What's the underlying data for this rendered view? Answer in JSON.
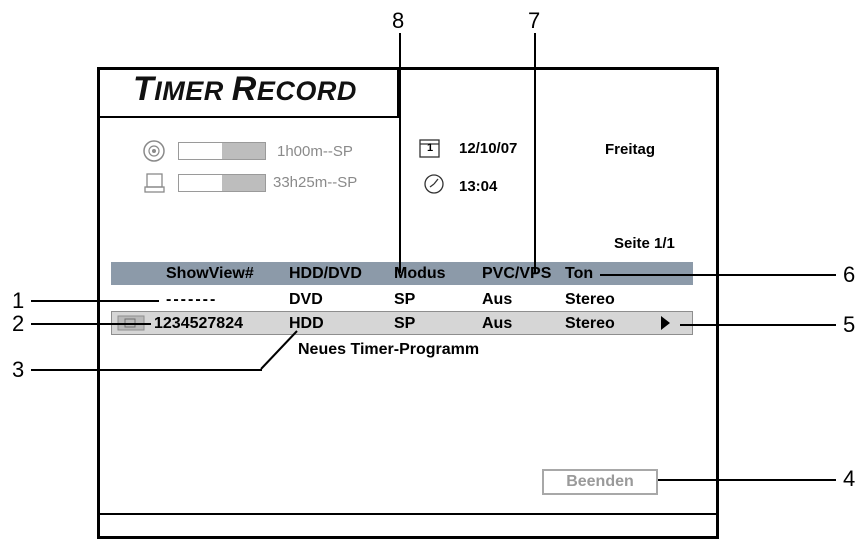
{
  "title": {
    "first_cap": "T",
    "rest1": "IMER ",
    "second_cap": "R",
    "rest2": "ECORD"
  },
  "storage": {
    "dvd": {
      "icon": "disc-icon",
      "remaining": "1h00m--SP",
      "fill_fraction": 0.5
    },
    "hdd": {
      "icon": "hard-disk-icon",
      "remaining": "33h25m--SP",
      "fill_fraction": 0.5
    }
  },
  "calendar_icon_text": "1",
  "date": "12/10/07",
  "time": "13:04",
  "weekday": "Freitag",
  "page": "Seite 1/1",
  "table": {
    "headers": {
      "showview": "ShowView#",
      "source": "HDD/DVD",
      "mode": "Modus",
      "pvc": "PVC/VPS",
      "sound": "Ton"
    },
    "rows": [
      {
        "showview": "-------",
        "source": "DVD",
        "mode": "SP",
        "pvc": "Aus",
        "sound": "Stereo"
      },
      {
        "showview": "1234527824",
        "source": "HDD",
        "mode": "SP",
        "pvc": "Aus",
        "sound": "Stereo"
      }
    ],
    "new_program": "Neues Timer-Programm"
  },
  "end_button": "Beenden",
  "callouts": {
    "c1": "1",
    "c2": "2",
    "c3": "3",
    "c4": "4",
    "c5": "5",
    "c6": "6",
    "c7": "7",
    "c8": "8"
  },
  "colors": {
    "header_bar": "#8c9aa9",
    "selected_row": "#d6d6d6",
    "greyed": "#8a8a8a"
  }
}
